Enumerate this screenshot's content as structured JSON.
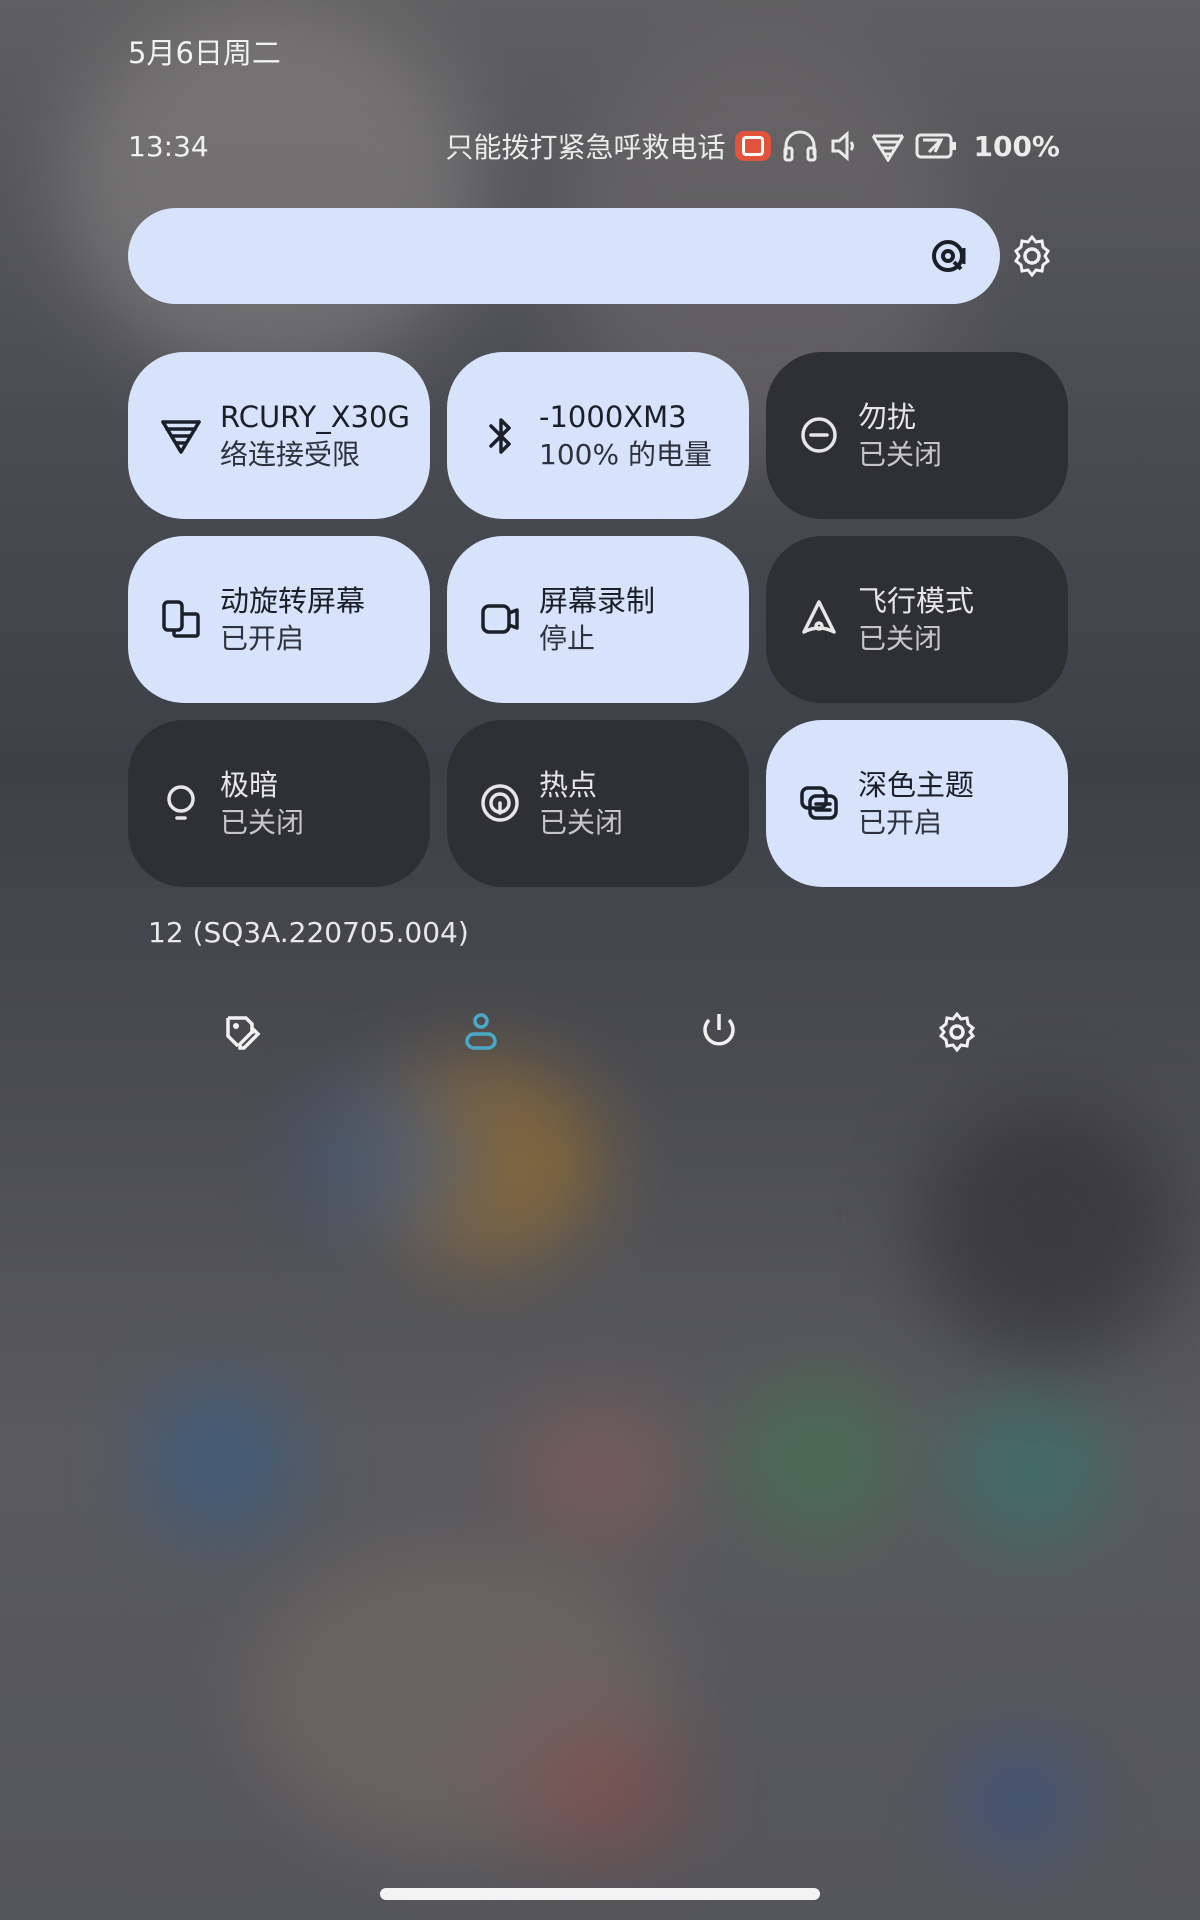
{
  "header": {
    "date": "5月6日周二",
    "time": "13:34",
    "carrier_status": "只能拨打紧急呼救电话",
    "battery_percent": "100%"
  },
  "status_icons": [
    "screen-record-icon",
    "headphones-icon",
    "volume-icon",
    "wifi-icon",
    "battery-charging-icon"
  ],
  "search": {
    "placeholder": ""
  },
  "tiles": [
    {
      "title": "RCURY_X30G",
      "subtitle": "络连接受限",
      "state": "on",
      "icon": "wifi-icon"
    },
    {
      "title": "-1000XM3",
      "subtitle": "100% 的电量",
      "state": "on",
      "icon": "bluetooth-headphones-icon"
    },
    {
      "title": "勿扰",
      "subtitle": "已关闭",
      "state": "off",
      "icon": "do-not-disturb-icon"
    },
    {
      "title": "动旋转屏幕",
      "subtitle": "已开启",
      "state": "on",
      "icon": "auto-rotate-icon"
    },
    {
      "title": "屏幕录制",
      "subtitle": "停止",
      "state": "on",
      "icon": "screen-record-icon"
    },
    {
      "title": "飞行模式",
      "subtitle": "已关闭",
      "state": "off",
      "icon": "airplane-mode-icon"
    },
    {
      "title": "极暗",
      "subtitle": "已关闭",
      "state": "off",
      "icon": "extra-dim-icon"
    },
    {
      "title": "热点",
      "subtitle": "已关闭",
      "state": "off",
      "icon": "hotspot-icon"
    },
    {
      "title": "深色主题",
      "subtitle": "已开启",
      "state": "on",
      "icon": "dark-theme-icon"
    }
  ],
  "build_number": "12 (SQ3A.220705.004)",
  "bottom_actions": [
    "edit-icon",
    "user-icon",
    "power-icon",
    "settings-icon"
  ],
  "colors": {
    "tile_on": "#d7e3fb",
    "tile_off": "#2f3033",
    "accent_user": "#4aa8c8",
    "record_badge": "#e2533b"
  }
}
